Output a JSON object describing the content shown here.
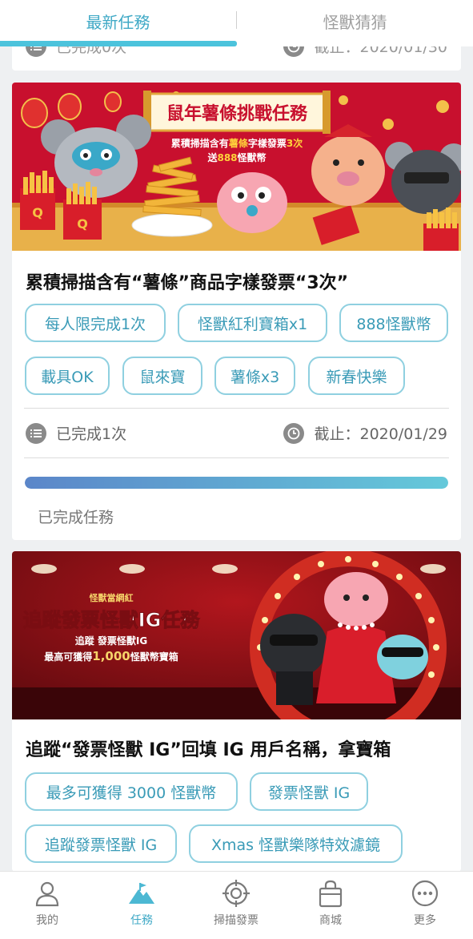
{
  "tabs": {
    "latest": "最新任務",
    "guess": "怪獸猜猜"
  },
  "prev_card": {
    "completed": "已完成0次",
    "deadline": "截止：2020/01/30"
  },
  "mission1": {
    "banner": {
      "headline": "鼠年薯條挑戰任務",
      "line1_pre": "累積掃描含有",
      "line1_highlight": "薯條",
      "line1_mid": "字樣發票",
      "line1_count": "3次",
      "line2_pre": "送",
      "line2_amount": "888",
      "line2_post": "怪獸幣"
    },
    "title": "累積掃描含有“薯條”商品字樣發票“3次”",
    "tags": [
      "每人限完成1次",
      "怪獸紅利寶箱x1",
      "888怪獸幣",
      "載具OK",
      "鼠來寶",
      "薯條x3",
      "新春快樂"
    ],
    "completed": "已完成1次",
    "deadline": "截止：2020/01/29",
    "progress_fraction": 1.0,
    "progress_label": "已完成任務"
  },
  "mission2": {
    "banner": {
      "kicker": "怪獸當網紅",
      "headline": "追蹤發票怪獸IG任務",
      "line1": "追蹤 發票怪獸IG",
      "line2_pre": "最高可獲得",
      "line2_amount": "1,000",
      "line2_post": "怪獸幣寶箱"
    },
    "title": "追蹤“發票怪獸 IG”回填 IG 用戶名稱，拿寶箱",
    "tags": [
      "最多可獲得 3000 怪獸幣",
      "發票怪獸 IG",
      "追蹤發票怪獸 IG",
      "Xmas 怪獸樂隊特效濾鏡"
    ]
  },
  "bottom_nav": [
    {
      "label": "我的",
      "icon": "person-icon"
    },
    {
      "label": "任務",
      "icon": "mountain-flag-icon"
    },
    {
      "label": "掃描發票",
      "icon": "target-scan-icon"
    },
    {
      "label": "商城",
      "icon": "shopping-bag-icon"
    },
    {
      "label": "更多",
      "icon": "more-dots-icon"
    }
  ],
  "colors": {
    "accent": "#3fa9c6",
    "tag_border": "#8fd0e0",
    "banner1_bg": "#c8102e",
    "banner2_bg": "#7a0d12"
  }
}
